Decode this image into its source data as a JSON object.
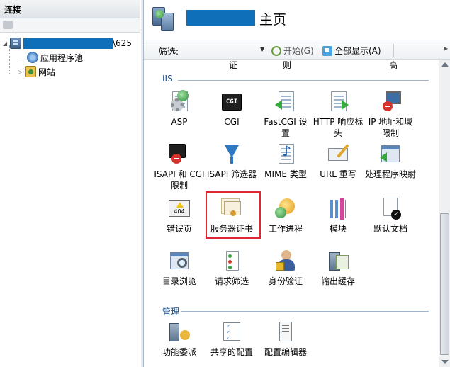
{
  "connections": {
    "title": "连接",
    "tree": {
      "server_suffix": "\\625",
      "app_pools": "应用程序池",
      "sites": "网站"
    }
  },
  "main": {
    "title": "主页",
    "filter": {
      "label": "筛选:",
      "placeholder": "",
      "go_label": "开始(G)",
      "show_all_label": "全部显示(A)"
    },
    "partial_row": [
      "证",
      "则",
      "高"
    ],
    "groups": {
      "iis": "IIS",
      "management": "管理"
    },
    "features": {
      "asp": "ASP",
      "cgi": "CGI",
      "fastcgi": "FastCGI 设置",
      "http_headers": "HTTP 响应标头",
      "ip_domain": "IP 地址和域限制",
      "isapi_cgi": "ISAPI 和 CGI 限制",
      "isapi_filters": "ISAPI 筛选器",
      "mime": "MIME 类型",
      "url_rewrite": "URL 重写",
      "handlers": "处理程序映射",
      "error_pages": "错误页",
      "server_certs": "服务器证书",
      "worker_processes": "工作进程",
      "modules": "模块",
      "default_doc": "默认文档",
      "dir_browsing": "目录浏览",
      "request_filtering": "请求筛选",
      "authentication": "身份验证",
      "output_caching": "输出缓存",
      "feature_delegation": "功能委派",
      "shared_config": "共享的配置",
      "config_editor": "配置编辑器"
    },
    "cgi_icon_text": "CGI",
    "error_icon_text": "404"
  },
  "colors": {
    "redaction": "#0f6fb8",
    "highlight": "#e0262f",
    "group_header": "#1d4f8c"
  }
}
